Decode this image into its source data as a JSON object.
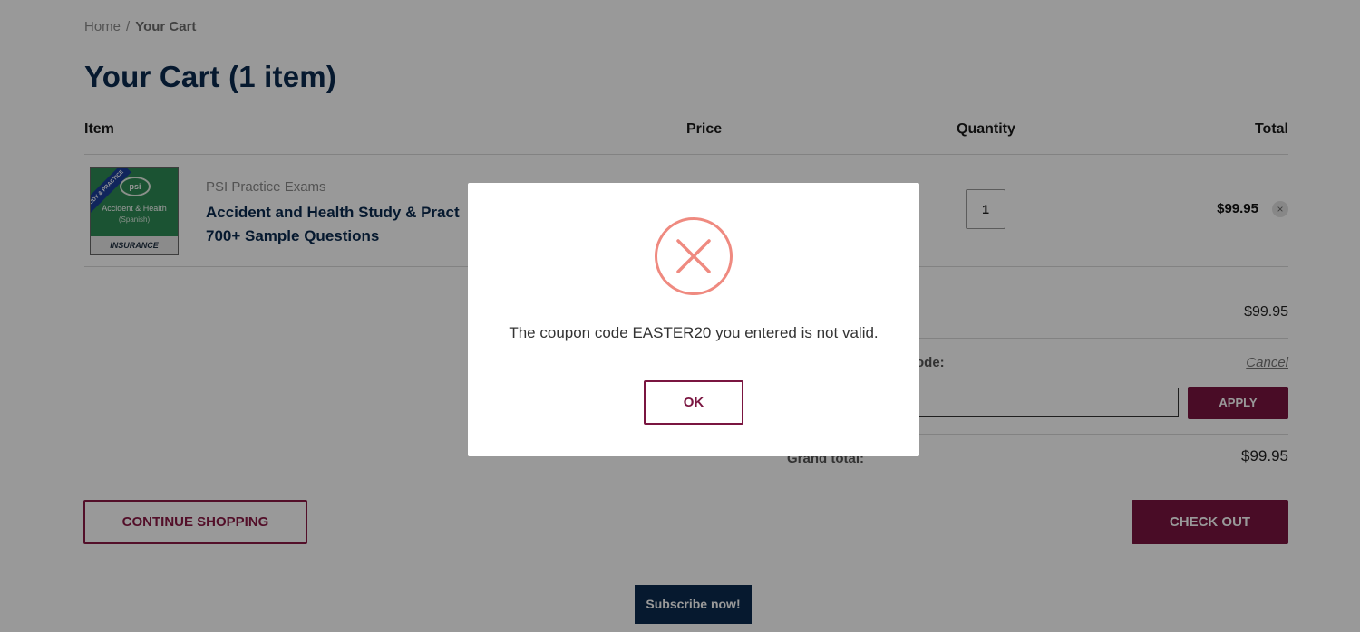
{
  "breadcrumb": {
    "home": "Home",
    "separator": "/",
    "current": "Your Cart"
  },
  "page_title": "Your Cart (1 item)",
  "table_headers": {
    "item": "Item",
    "price": "Price",
    "quantity": "Quantity",
    "total": "Total"
  },
  "cart_item": {
    "thumbnail": {
      "ribbon": "STUDY & PRACTICE",
      "logo": "psi",
      "title": "Accident & Health",
      "subtitle": "(Spanish)",
      "band": "INSURANCE"
    },
    "brand": "PSI Practice Exams",
    "name_line1": "Accident and Health Study & Pract",
    "name_line2": "700+ Sample Questions",
    "quantity": "1",
    "total": "$99.95",
    "remove_icon": "×"
  },
  "summary": {
    "subtotal_value": "$99.95",
    "coupon_label": "ode:",
    "cancel_label": "Cancel",
    "apply_label": "APPLY",
    "grand_total_label": "Grand total:",
    "grand_total_value": "$99.95"
  },
  "actions": {
    "continue_label": "CONTINUE SHOPPING",
    "checkout_label": "CHECK OUT",
    "subscribe_label": "Subscribe now!"
  },
  "modal": {
    "icon": "error-x-icon",
    "message": "The coupon code EASTER20 you entered is not valid.",
    "ok_label": "OK"
  },
  "colors": {
    "brand_navy": "#0a2a4f",
    "brand_maroon": "#7a1540",
    "error_red": "#ef8a80"
  }
}
